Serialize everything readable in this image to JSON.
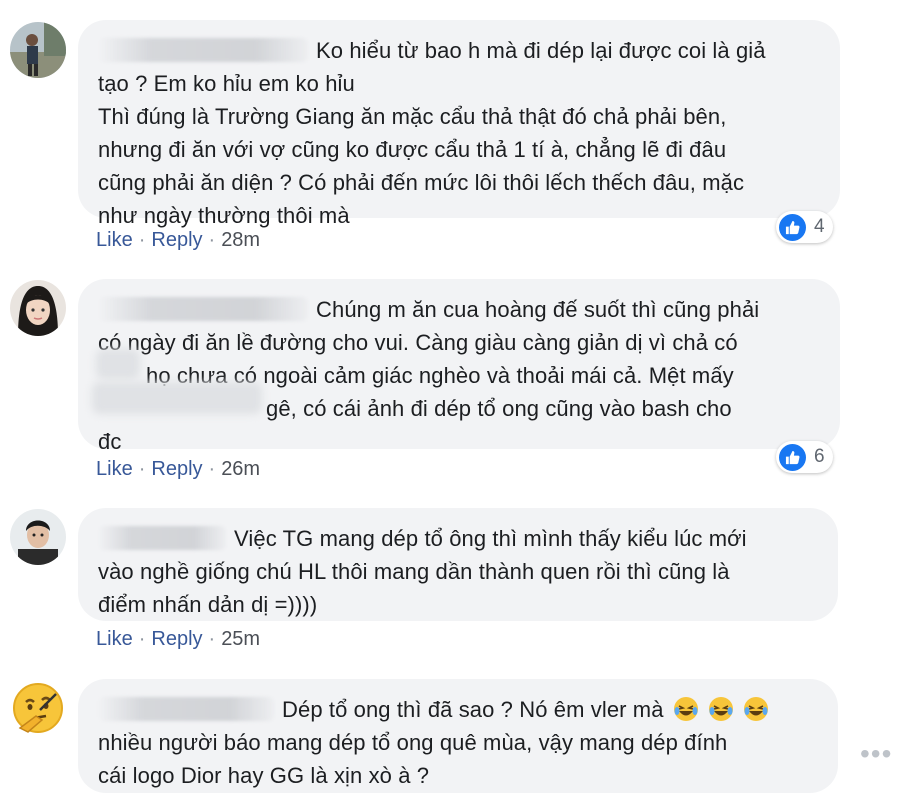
{
  "comments": [
    {
      "lines": [
        "Ko hiểu từ bao h mà đi dép lại được coi là giả",
        "tạo ? Em ko hỉu em ko hỉu",
        "Thì đúng là Trường Giang ăn mặc cẩu thả thật đó chả phải bên,",
        "nhưng đi ăn với vợ cũng ko được cẩu thả 1 tí à, chẳng lẽ đi đâu",
        "cũng phải ăn diện ? Có phải đến mức lôi thôi lếch thếch đâu, mặc",
        "như ngày thường thôi mà"
      ],
      "like": "Like",
      "reply": "Reply",
      "time": "28m",
      "reaction_count": "4"
    },
    {
      "lines": [
        "Chúng m ăn cua hoàng đế suốt thì cũng phải",
        "có ngày đi ăn lề đường cho vui. Càng giàu càng giản dị vì chả có",
        "họ chưa có ngoài cảm giác nghèo và thoải mái cả. Mệt mấy",
        "gê, có cái ảnh đi dép tổ ong cũng vào bash cho",
        "đc"
      ],
      "like": "Like",
      "reply": "Reply",
      "time": "26m",
      "reaction_count": "6"
    },
    {
      "lines": [
        "Việc TG mang dép tổ ông thì mình thấy kiểu lúc mới",
        "vào nghề giống chú HL thôi mang dần thành quen rồi thì cũng là",
        "điểm nhấn dản dị =))))"
      ],
      "like": "Like",
      "reply": "Reply",
      "time": "25m"
    },
    {
      "lines": [
        "Dép tổ ong thì đã sao ? Nó êm vler mà",
        "nhiều người báo mang dép tổ ong quê mùa, vậy mang dép đính",
        "cái logo Dior hay GG là xịn xò à ?"
      ]
    }
  ],
  "more_label": "•••",
  "colors": {
    "bubble": "#f2f3f5",
    "link": "#385898",
    "like_blue": "#1877f2"
  }
}
